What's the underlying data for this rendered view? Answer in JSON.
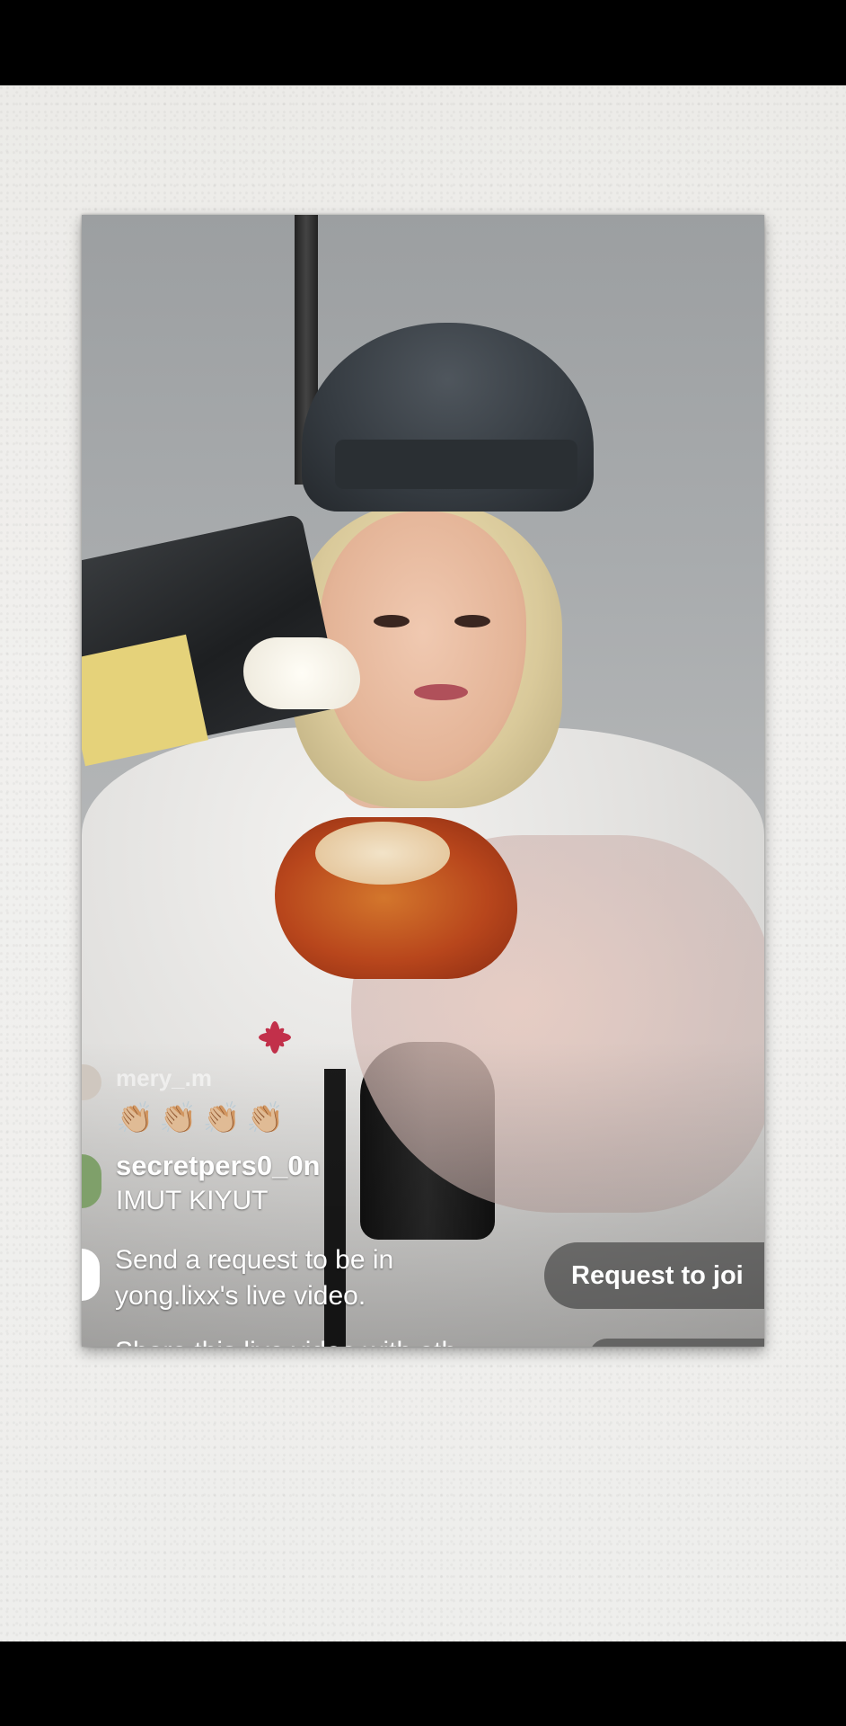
{
  "live": {
    "comments": [
      {
        "username": "mery_.m",
        "emojis": "👏🏼👏🏼👏🏼👏🏼"
      },
      {
        "username": "secretpers0_0n",
        "message": "IMUT KIYUT"
      }
    ],
    "system_message": "Send a request to be in yong.lixx's live video.",
    "request_button": "Request to joi",
    "truncated_line": "Share this live video with oth..."
  },
  "colors": {
    "background_wall": "#efeeec",
    "letterbox": "#000000",
    "overlay_text": "#ffffff"
  }
}
